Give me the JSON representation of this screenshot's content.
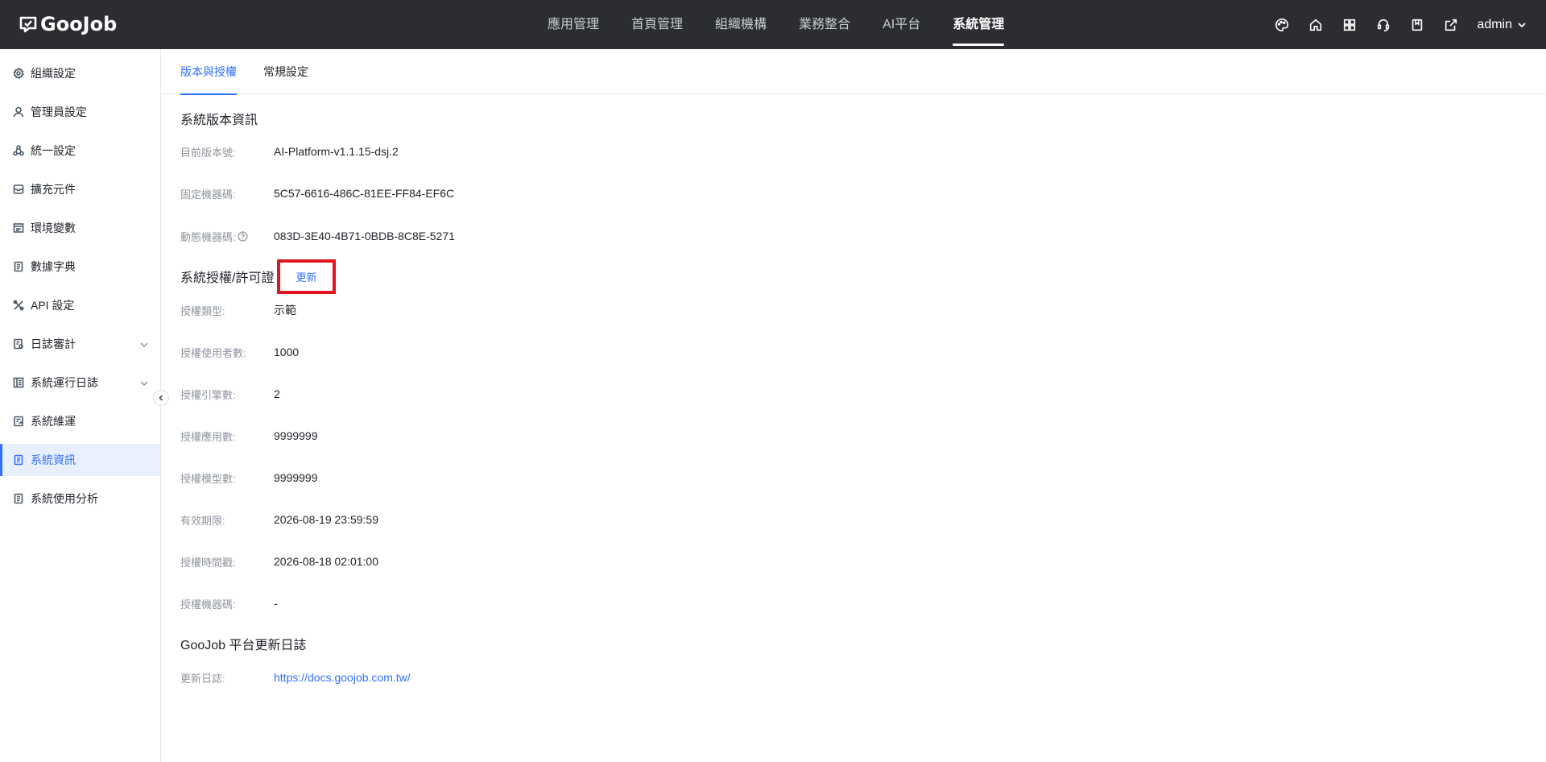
{
  "header": {
    "logo_text": "GooJob",
    "nav": [
      "應用管理",
      "首頁管理",
      "組織機構",
      "業務整合",
      "AI平台",
      "系統管理"
    ],
    "active_nav_index": 5,
    "icons": [
      "palette-icon",
      "home-icon",
      "apps-grid-icon",
      "support-icon",
      "book-icon",
      "export-icon"
    ],
    "user": "admin"
  },
  "sidebar": {
    "items": [
      {
        "label": "組織設定",
        "icon": "gear-icon"
      },
      {
        "label": "管理員設定",
        "icon": "user-icon"
      },
      {
        "label": "統一設定",
        "icon": "cycle-icon"
      },
      {
        "label": "擴充元件",
        "icon": "box-icon"
      },
      {
        "label": "環境變數",
        "icon": "window-icon"
      },
      {
        "label": "數據字典",
        "icon": "document-icon"
      },
      {
        "label": "API 設定",
        "icon": "tools-icon"
      },
      {
        "label": "日誌審計",
        "icon": "audit-icon",
        "expandable": true
      },
      {
        "label": "系統運行日誌",
        "icon": "log-icon",
        "expandable": true
      },
      {
        "label": "系統維運",
        "icon": "maintenance-icon"
      },
      {
        "label": "系統資訊",
        "icon": "info-doc-icon",
        "active": true
      },
      {
        "label": "系統使用分析",
        "icon": "analysis-icon"
      }
    ]
  },
  "tabs": [
    "版本與授權",
    "常規設定"
  ],
  "active_tab_index": 0,
  "version_section": {
    "title": "系統版本資訊",
    "rows": [
      {
        "label": "目前版本號:",
        "value": "AI-Platform-v1.1.15-dsj.2"
      },
      {
        "label": "固定機器碼:",
        "value": "5C57-6616-486C-81EE-FF84-EF6C"
      },
      {
        "label": "動態機器碼:",
        "value": "083D-3E40-4B71-0BDB-8C8E-5271"
      }
    ]
  },
  "license_section": {
    "title": "系統授權/許可證",
    "update_label": "更新",
    "rows": [
      {
        "label": "授權類型:",
        "value": "示範"
      },
      {
        "label": "授權使用者數:",
        "value": "1000"
      },
      {
        "label": "授權引擎數:",
        "value": "2"
      },
      {
        "label": "授權應用數:",
        "value": "9999999"
      },
      {
        "label": "授權模型數:",
        "value": "9999999"
      },
      {
        "label": "有效期限:",
        "value": "2026-08-19 23:59:59"
      },
      {
        "label": "授權時間戳:",
        "value": "2026-08-18 02:01:00"
      },
      {
        "label": "授權機器碼:",
        "value": "-"
      }
    ]
  },
  "changelog_section": {
    "title": "GooJob 平台更新日誌",
    "label": "更新日誌:",
    "link": "https://docs.goojob.com.tw/"
  },
  "colors": {
    "topbar": "#2b2d31",
    "accent": "#3370ff",
    "highlight_box": "#e0151f"
  }
}
